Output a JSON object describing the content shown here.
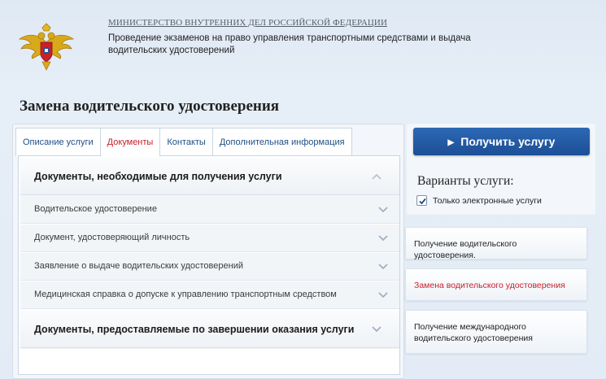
{
  "header": {
    "ministry": "МИНИСТЕРСТВО ВНУТРЕННИХ ДЕЛ РОССИЙСКОЙ ФЕДЕРАЦИИ",
    "subtitle": "Проведение экзаменов на право управления транспортными средствами и выдача водительских удостоверений",
    "emblem_icon": "double-headed-eagle-emblem"
  },
  "page_title": "Замена водительского удостоверения",
  "tabs": [
    {
      "label": "Описание услуги",
      "active": false
    },
    {
      "label": "Документы",
      "active": true
    },
    {
      "label": "Контакты",
      "active": false
    },
    {
      "label": "Дополнительная информация",
      "active": false
    }
  ],
  "documents": {
    "section_required": "Документы, необходимые для получения услуги",
    "items": [
      "Водительское удостоверение",
      "Документ, удостоверяющий личность",
      "Заявление о выдаче водительских удостоверений",
      "Медицинская справка о допуске к управлению транспортным средством"
    ],
    "section_result": "Документы, предоставляемые по завершении оказания услуги"
  },
  "sidebar": {
    "get_service_button": "Получить услугу",
    "variants_title": "Варианты услуги:",
    "electronic_only_label": "Только электронные услуги",
    "electronic_only_checked": true,
    "variants": [
      {
        "label": "Получение водительского удостоверения.",
        "active": false
      },
      {
        "label": "Замена водительского удостоверения",
        "active": true
      },
      {
        "label": "Получение международного водительского удостоверения",
        "active": false
      }
    ]
  },
  "colors": {
    "accent_red": "#c8202c",
    "primary_blue": "#1c4f96",
    "link_blue": "#1f4f86"
  }
}
